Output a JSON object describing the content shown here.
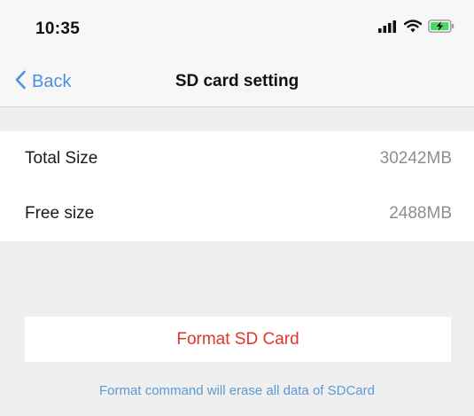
{
  "status_bar": {
    "time": "10:35",
    "icons": [
      "signal-icon",
      "wifi-icon",
      "battery-charging-icon"
    ]
  },
  "nav": {
    "back_label": "Back",
    "title": "SD card setting"
  },
  "storage": {
    "rows": [
      {
        "label": "Total Size",
        "value": "30242MB"
      },
      {
        "label": "Free size",
        "value": "2488MB"
      }
    ]
  },
  "actions": {
    "format_label": "Format SD Card",
    "hint": "Format command will erase all data of SDCard"
  },
  "colors": {
    "accent": "#4a90e2",
    "danger": "#e0352b",
    "battery": "#4cd964"
  }
}
